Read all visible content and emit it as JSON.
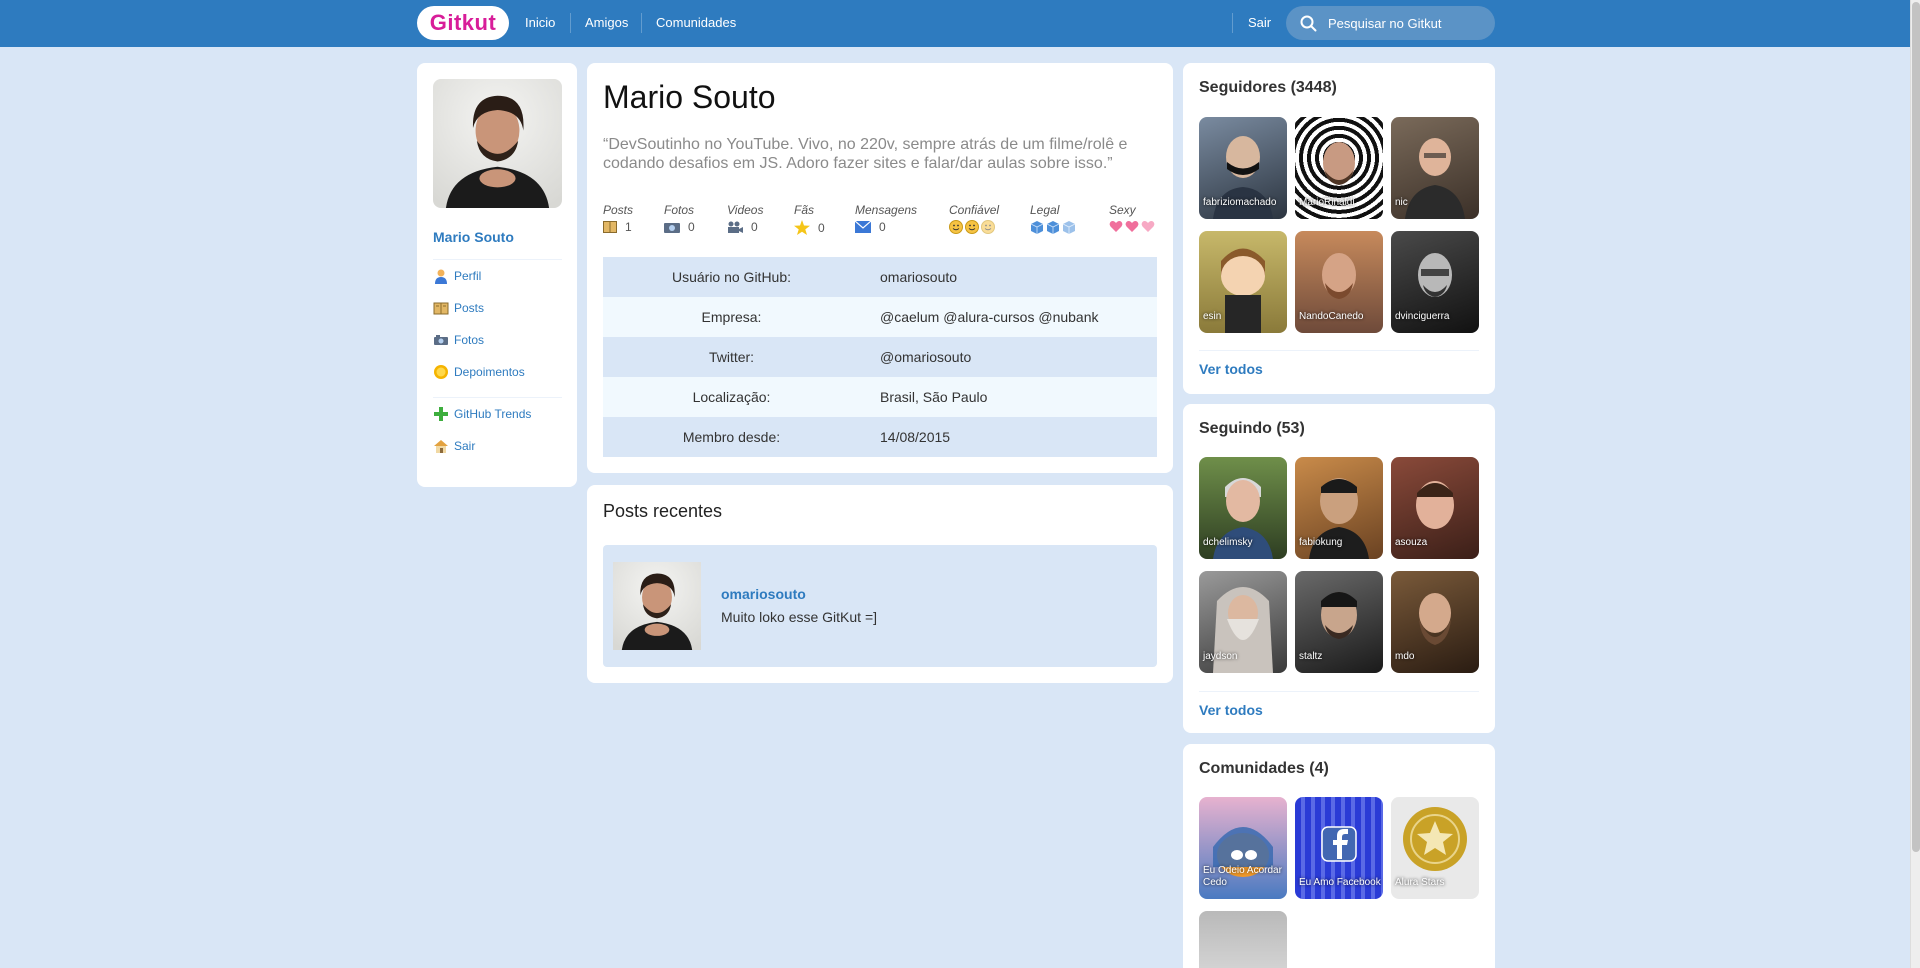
{
  "header": {
    "logo": "Gitkut",
    "nav": [
      "Inicio",
      "Amigos",
      "Comunidades"
    ],
    "logout": "Sair",
    "search_placeholder": "Pesquisar no Gitkut"
  },
  "sidebar": {
    "name": "Mario Souto",
    "items": [
      {
        "label": "Perfil",
        "icon": "user-icon"
      },
      {
        "label": "Posts",
        "icon": "book-icon"
      },
      {
        "label": "Fotos",
        "icon": "camera-icon"
      },
      {
        "label": "Depoimentos",
        "icon": "sun-icon"
      },
      {
        "label": "GitHub Trends",
        "icon": "plus-icon"
      },
      {
        "label": "Sair",
        "icon": "home-icon"
      }
    ]
  },
  "profile": {
    "name": "Mario Souto",
    "bio": "“DevSoutinho no YouTube. Vivo, no 220v, sempre atrás de um filme/rolê e codando desafios em JS. Adoro fazer sites e falar/dar aulas sobre isso.”",
    "stats": [
      {
        "label": "Posts",
        "value": "1",
        "icon": "book-icon"
      },
      {
        "label": "Fotos",
        "value": "0",
        "icon": "camera-icon"
      },
      {
        "label": "Videos",
        "value": "0",
        "icon": "video-camera-icon"
      },
      {
        "label": "Fãs",
        "value": "0",
        "icon": "star-icon"
      },
      {
        "label": "Mensagens",
        "value": "0",
        "icon": "mail-icon"
      }
    ],
    "ratings": [
      {
        "label": "Confiável",
        "icon": "smiley-icon",
        "count": 3
      },
      {
        "label": "Legal",
        "icon": "ice-cube-icon",
        "count": 3
      },
      {
        "label": "Sexy",
        "icon": "heart-icon",
        "count": 3
      }
    ],
    "info": [
      {
        "key": "Usuário no GitHub:",
        "value": "omariosouto"
      },
      {
        "key": "Empresa:",
        "value": "@caelum @alura-cursos @nubank"
      },
      {
        "key": "Twitter:",
        "value": "@omariosouto"
      },
      {
        "key": "Localização:",
        "value": "Brasil, São Paulo"
      },
      {
        "key": "Membro desde:",
        "value": "14/08/2015"
      }
    ]
  },
  "posts": {
    "title": "Posts recentes",
    "items": [
      {
        "user": "omariosouto",
        "text": "Muito loko esse GitKut =]"
      }
    ]
  },
  "followers": {
    "title": "Seguidores (3448)",
    "users": [
      "fabriziomachado",
      "MarioRinaldi",
      "nic",
      "esin",
      "NandoCanedo",
      "dvinciguerra"
    ],
    "see_all": "Ver todos"
  },
  "following": {
    "title": "Seguindo (53)",
    "users": [
      "dchelimsky",
      "fabiokung",
      "asouza",
      "jaydson",
      "staltz",
      "mdo"
    ],
    "see_all": "Ver todos"
  },
  "communities": {
    "title": "Comunidades (4)",
    "items": [
      "Eu Odeio Acordar Cedo",
      "Eu Amo Facebook",
      "Alura Stars",
      ""
    ]
  },
  "colors": {
    "brand": "#d81d99",
    "primary": "#2e7bbf",
    "background": "#d9e6f6"
  }
}
